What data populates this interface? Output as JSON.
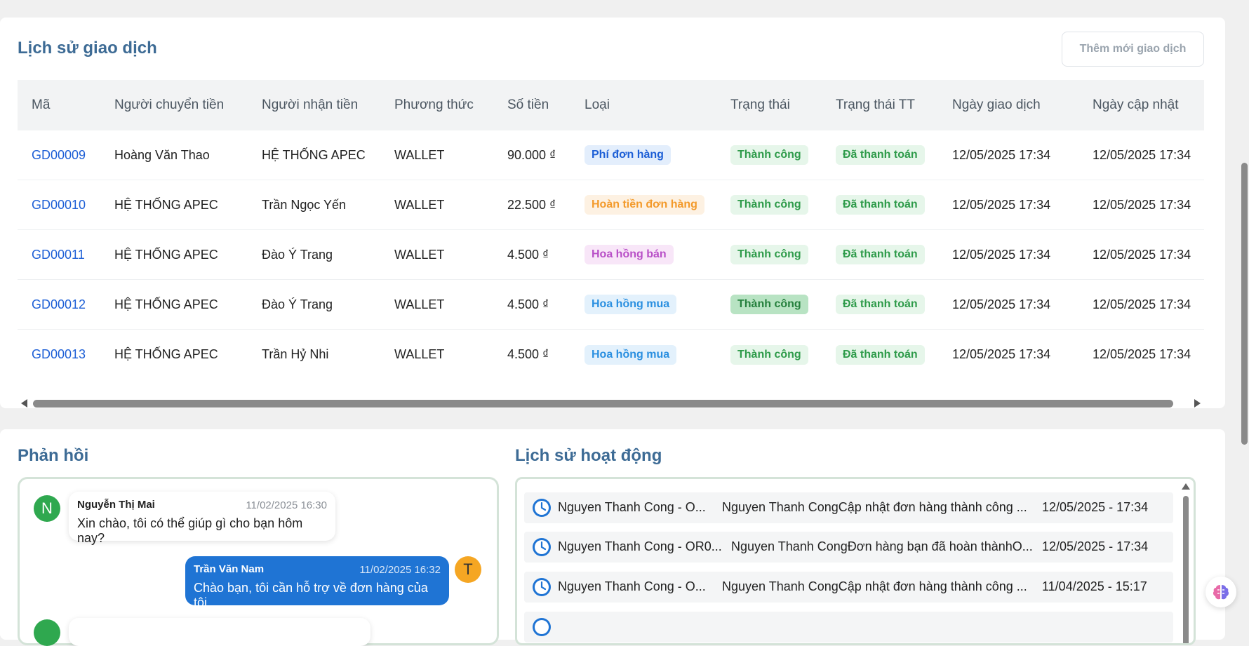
{
  "transactions": {
    "title": "Lịch sử giao dịch",
    "add_button": "Thêm mới giao dịch",
    "columns": [
      "Mã",
      "Người chuyển tiền",
      "Người nhận tiền",
      "Phương thức",
      "Số tiền",
      "Loại",
      "Trạng thái",
      "Trạng thái TT",
      "Ngày giao dịch",
      "Ngày cập nhật"
    ],
    "rows": [
      {
        "code": "GD00009",
        "sender": "Hoàng Văn Thao",
        "receiver": "HỆ THỐNG APEC",
        "method": "WALLET",
        "amount": "90.000 ₫",
        "type": "Phí đơn hàng",
        "status": "Thành công",
        "pay_status": "Đã thanh toán",
        "created": "12/05/2025 17:34",
        "updated": "12/05/2025 17:34"
      },
      {
        "code": "GD00010",
        "sender": "HỆ THỐNG APEC",
        "receiver": "Trần Ngọc Yến",
        "method": "WALLET",
        "amount": "22.500 ₫",
        "type": "Hoàn tiền đơn hàng",
        "status": "Thành công",
        "pay_status": "Đã thanh toán",
        "created": "12/05/2025 17:34",
        "updated": "12/05/2025 17:34"
      },
      {
        "code": "GD00011",
        "sender": "HỆ THỐNG APEC",
        "receiver": "Đào Ý Trang",
        "method": "WALLET",
        "amount": "4.500 ₫",
        "type": "Hoa hồng bán",
        "status": "Thành công",
        "pay_status": "Đã thanh toán",
        "created": "12/05/2025 17:34",
        "updated": "12/05/2025 17:34"
      },
      {
        "code": "GD00012",
        "sender": "HỆ THỐNG APEC",
        "receiver": "Đào Ý Trang",
        "method": "WALLET",
        "amount": "4.500 ₫",
        "type": "Hoa hồng mua",
        "status": "Thành công",
        "pay_status": "Đã thanh toán",
        "created": "12/05/2025 17:34",
        "updated": "12/05/2025 17:34"
      },
      {
        "code": "GD00013",
        "sender": "HỆ THỐNG APEC",
        "receiver": "Trần Hỷ Nhi",
        "method": "WALLET",
        "amount": "4.500 ₫",
        "type": "Hoa hồng mua",
        "status": "Thành công",
        "pay_status": "Đã thanh toán",
        "created": "12/05/2025 17:34",
        "updated": "12/05/2025 17:34"
      }
    ]
  },
  "feedback": {
    "title": "Phản hồi",
    "messages": [
      {
        "avatar": "N",
        "name": "Nguyễn Thị Mai",
        "time": "11/02/2025 16:30",
        "text": "Xin chào, tôi có thể giúp gì cho bạn hôm nay?"
      },
      {
        "avatar": "T",
        "name": "Trần Văn Nam",
        "time": "11/02/2025 16:32",
        "text": "Chào bạn, tôi cần hỗ trợ về đơn hàng của tôi."
      }
    ]
  },
  "activity": {
    "title": "Lịch sử hoạt động",
    "rows": [
      {
        "actor": "Nguyen Thanh Cong - O...",
        "desc": "Nguyen Thanh CongCập nhật đơn hàng thành công ...",
        "time": "12/05/2025 - 17:34"
      },
      {
        "actor": "Nguyen Thanh Cong - OR0...",
        "desc": "Nguyen Thanh CongĐơn hàng bạn đã hoàn thànhO...",
        "time": "12/05/2025 - 17:34"
      },
      {
        "actor": "Nguyen Thanh Cong - O...",
        "desc": "Nguyen Thanh CongCập nhật đơn hàng thành công ...",
        "time": "11/04/2025 - 15:17"
      }
    ]
  },
  "colors": {
    "accent": "#3d6b95",
    "link": "#1d5fd6",
    "success": "#2e9b4a",
    "bubble_out": "#1f74d4",
    "avatar_n": "#2fa84f",
    "avatar_t": "#f5a623"
  }
}
